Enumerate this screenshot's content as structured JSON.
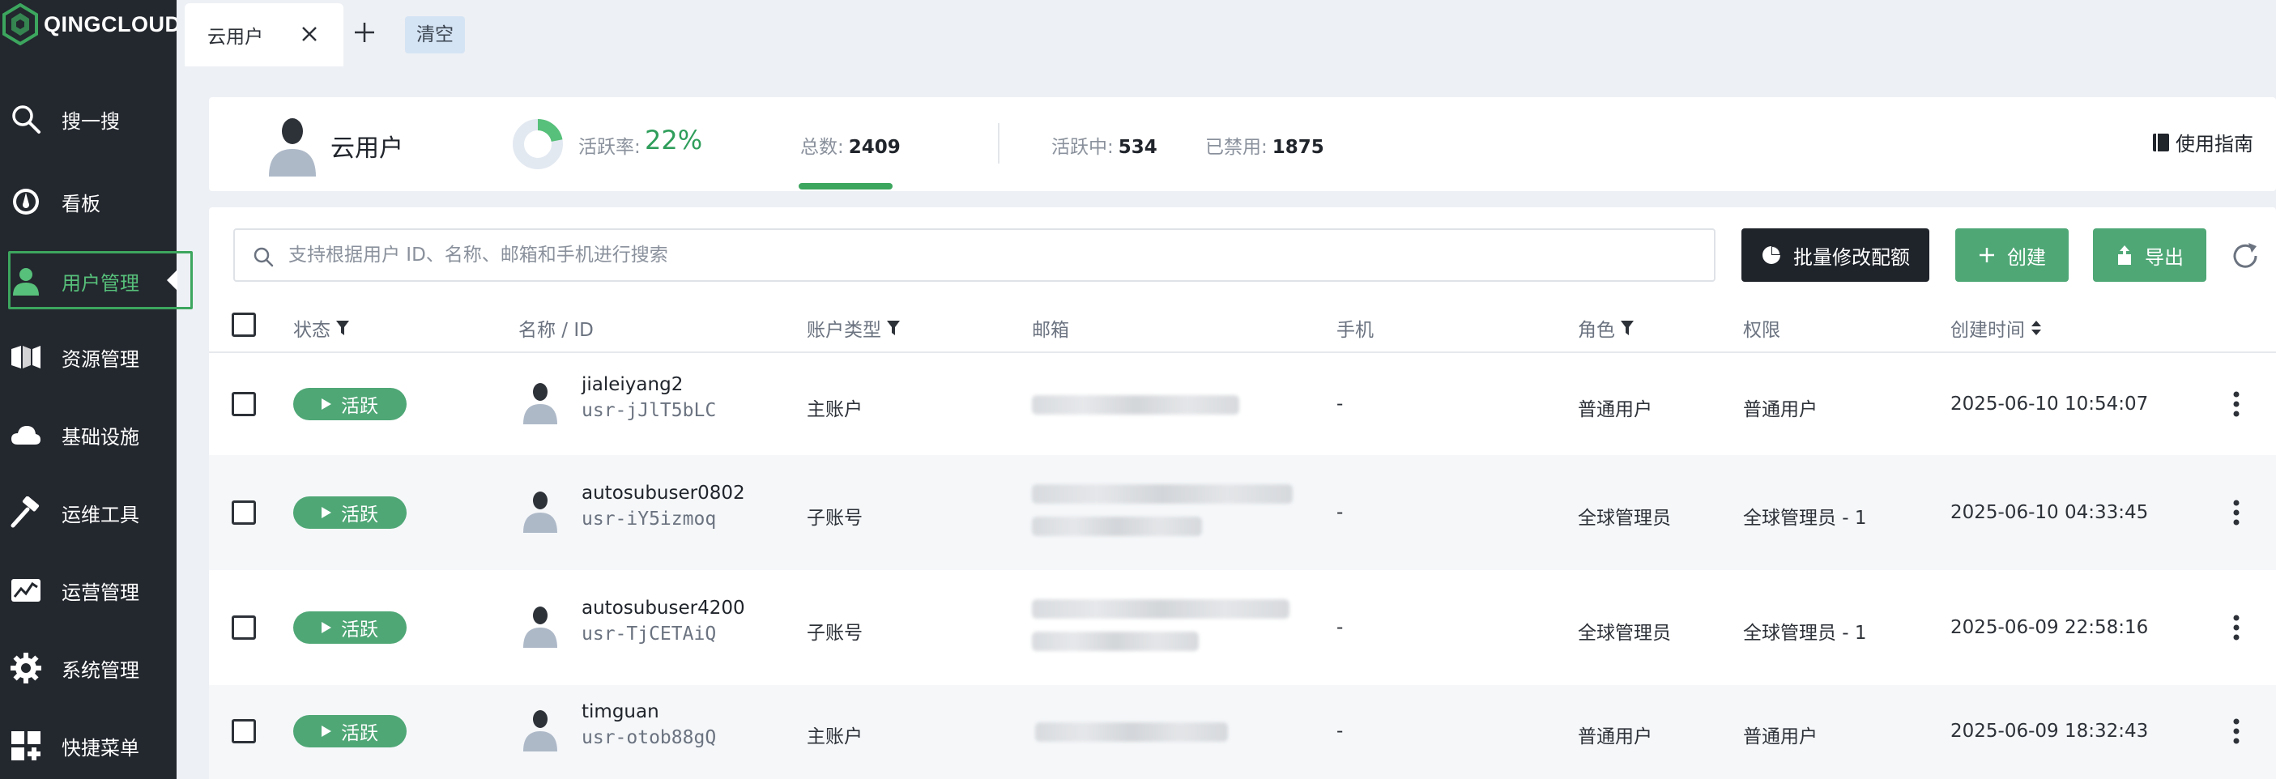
{
  "brand": {
    "name": "QINGCLOUD"
  },
  "sidebar": {
    "items": [
      {
        "label": "搜一搜",
        "icon": "search-icon"
      },
      {
        "label": "看板",
        "icon": "dashboard-icon"
      },
      {
        "label": "用户管理",
        "icon": "user-icon",
        "active": true
      },
      {
        "label": "资源管理",
        "icon": "resource-icon"
      },
      {
        "label": "基础设施",
        "icon": "cloud-icon"
      },
      {
        "label": "运维工具",
        "icon": "hammer-icon"
      },
      {
        "label": "运营管理",
        "icon": "trend-icon"
      },
      {
        "label": "系统管理",
        "icon": "gear-icon"
      },
      {
        "label": "快捷菜单",
        "icon": "grid-plus-icon"
      }
    ]
  },
  "tabs": {
    "items": [
      {
        "label": "云用户",
        "active": true
      }
    ],
    "clear_label": "清空"
  },
  "summary": {
    "title": "云用户",
    "active_rate_label": "活跃率:",
    "active_rate_value": "22%",
    "active_rate_fraction": 0.22,
    "total_label": "总数:",
    "total_value": "2409",
    "active_label": "活跃中:",
    "active_value": "534",
    "disabled_label": "已禁用:",
    "disabled_value": "1875",
    "guide_label": "使用指南"
  },
  "search": {
    "placeholder": "支持根据用户 ID、名称、邮箱和手机进行搜索",
    "value": ""
  },
  "actions": {
    "bulk_quota_label": "批量修改配额",
    "create_label": "创建",
    "export_label": "导出"
  },
  "table": {
    "columns": {
      "status": "状态",
      "name": "名称 / ID",
      "account_type": "账户类型",
      "email": "邮箱",
      "phone": "手机",
      "role": "角色",
      "permission": "权限",
      "created": "创建时间"
    },
    "rows": [
      {
        "status": "活跃",
        "name": "jialeiyang2",
        "id": "usr-jJlT5bLC",
        "account_type": "主账户",
        "phone": "-",
        "role": "普通用户",
        "permission": "普通用户",
        "created": "2025-06-10 10:54:07"
      },
      {
        "status": "活跃",
        "name": "autosubuser0802",
        "id": "usr-iY5izmoq",
        "account_type": "子账号",
        "phone": "-",
        "role": "全球管理员",
        "permission": "全球管理员 - 1",
        "created": "2025-06-10 04:33:45"
      },
      {
        "status": "活跃",
        "name": "autosubuser4200",
        "id": "usr-TjCETAiQ",
        "account_type": "子账号",
        "phone": "-",
        "role": "全球管理员",
        "permission": "全球管理员 - 1",
        "created": "2025-06-09 22:58:16"
      },
      {
        "status": "活跃",
        "name": "timguan",
        "id": "usr-otob88gQ",
        "account_type": "主账户",
        "phone": "-",
        "role": "普通用户",
        "permission": "普通用户",
        "created": "2025-06-09 18:32:43"
      }
    ]
  },
  "colors": {
    "sidebar_bg": "#23272e",
    "accent_green": "#4fa776",
    "active_green": "#3ca65e",
    "dark_button": "#1f232a"
  }
}
